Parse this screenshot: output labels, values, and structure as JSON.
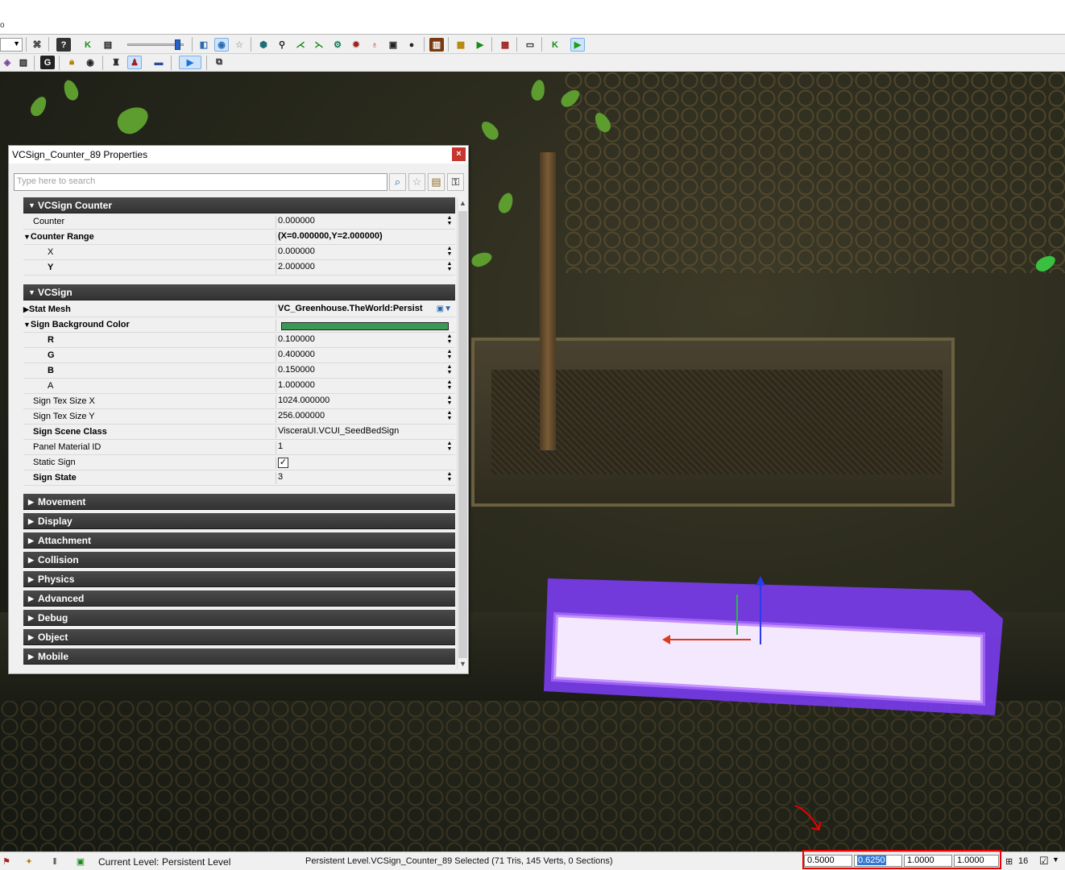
{
  "menu_fragment": "o",
  "toolbar": {
    "row1_icons": [
      "binoculars-icon",
      "help-icon",
      "kismet-icon",
      "clapper-icon",
      "viewport-icon",
      "realtime-icon",
      "star-icon",
      "shield-icon",
      "pin-icon",
      "node-icon",
      "node2-icon",
      "gear-icon",
      "cog-icon",
      "bulb-icon",
      "monitor-icon",
      "sphere-icon",
      "book-icon",
      "save-icon",
      "map-icon",
      "box-icon",
      "screen-icon",
      "kismet-run-icon",
      "play-icon"
    ],
    "row2_icons": [
      "cube-icon",
      "cubes-icon",
      "g-icon",
      "lock-icon",
      "eye-icon",
      "camera-icon",
      "actor-icon",
      "floppy-icon",
      "play-in-viewport-icon",
      "link-icon"
    ]
  },
  "properties": {
    "title": "VCSign_Counter_89 Properties",
    "search_placeholder": "Type here to search",
    "sections": {
      "vcsign_counter": "VCSign Counter",
      "vcsign": "VCSign",
      "collapsed": [
        "Movement",
        "Display",
        "Attachment",
        "Collision",
        "Physics",
        "Advanced",
        "Debug",
        "Object",
        "Mobile"
      ]
    },
    "rows": {
      "counter": {
        "label": "Counter",
        "value": "0.000000"
      },
      "counter_range": {
        "label": "Counter Range",
        "value": "(X=0.000000,Y=2.000000)"
      },
      "x": {
        "label": "X",
        "value": "0.000000"
      },
      "y": {
        "label": "Y",
        "value": "2.000000"
      },
      "stat_mesh": {
        "label": "Stat Mesh",
        "value": "VC_Greenhouse.TheWorld:Persist"
      },
      "sign_bg_color": {
        "label": "Sign Background Color",
        "color": "#3a9a55"
      },
      "r": {
        "label": "R",
        "value": "0.100000"
      },
      "g": {
        "label": "G",
        "value": "0.400000"
      },
      "b": {
        "label": "B",
        "value": "0.150000"
      },
      "a": {
        "label": "A",
        "value": "1.000000"
      },
      "tex_x": {
        "label": "Sign Tex Size X",
        "value": "1024.000000"
      },
      "tex_y": {
        "label": "Sign Tex Size Y",
        "value": "256.000000"
      },
      "scene_class": {
        "label": "Sign Scene Class",
        "value": "VisceraUI.VCUI_SeedBedSign"
      },
      "panel_mat": {
        "label": "Panel Material ID",
        "value": "1"
      },
      "static_sign": {
        "label": "Static Sign",
        "checked": true
      },
      "sign_state": {
        "label": "Sign State",
        "value": "3"
      }
    }
  },
  "statusbar": {
    "level_label": "Current Level:",
    "level_value": "Persistent Level",
    "selection": "Persistent Level.VCSign_Counter_89 Selected (71 Tris, 145 Verts, 0 Sections)",
    "values": [
      "0.5000",
      "0.6250",
      "1.0000",
      "1.0000"
    ],
    "grid": "16"
  },
  "colors": {
    "sign_glow": "#7a3cf0",
    "accent": "#3377d6"
  }
}
